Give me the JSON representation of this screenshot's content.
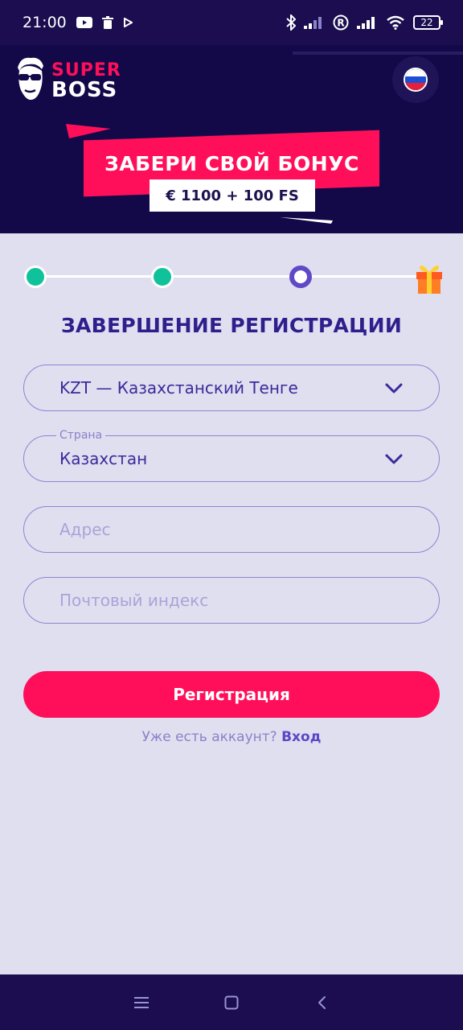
{
  "status_bar": {
    "time": "21:00",
    "battery": "22"
  },
  "header": {
    "logo": {
      "super": "SUPER",
      "boss": "BOSS"
    },
    "language": "ru"
  },
  "banner": {
    "title": "ЗАБЕРИ СВОЙ БОНУС",
    "bonus": "€ 1100 + 100 FS"
  },
  "steps": {
    "total": 4,
    "completed": 2,
    "current": 3
  },
  "form": {
    "title": "ЗАВЕРШЕНИЕ РЕГИСТРАЦИИ",
    "currency": {
      "value": "KZT — Казахстанский Тенге"
    },
    "country": {
      "label": "Страна",
      "value": "Казахстан"
    },
    "address": {
      "placeholder": "Адрес"
    },
    "postal_code": {
      "placeholder": "Почтовый индекс"
    },
    "submit_label": "Регистрация",
    "login_prompt": "Уже есть аккаунт?",
    "login_link": "Вход"
  },
  "colors": {
    "accent": "#ff0f5a",
    "primary": "#2f1f8c",
    "header_bg": "#130848",
    "step_done": "#10c29b",
    "step_current": "#6049c6"
  },
  "icons": {
    "status": [
      "youtube-icon",
      "trash-icon",
      "play-icon",
      "bluetooth-icon",
      "signal-icon",
      "registered-icon",
      "wifi-icon",
      "battery-icon"
    ],
    "nav": [
      "menu-icon",
      "home-icon",
      "back-icon"
    ]
  }
}
